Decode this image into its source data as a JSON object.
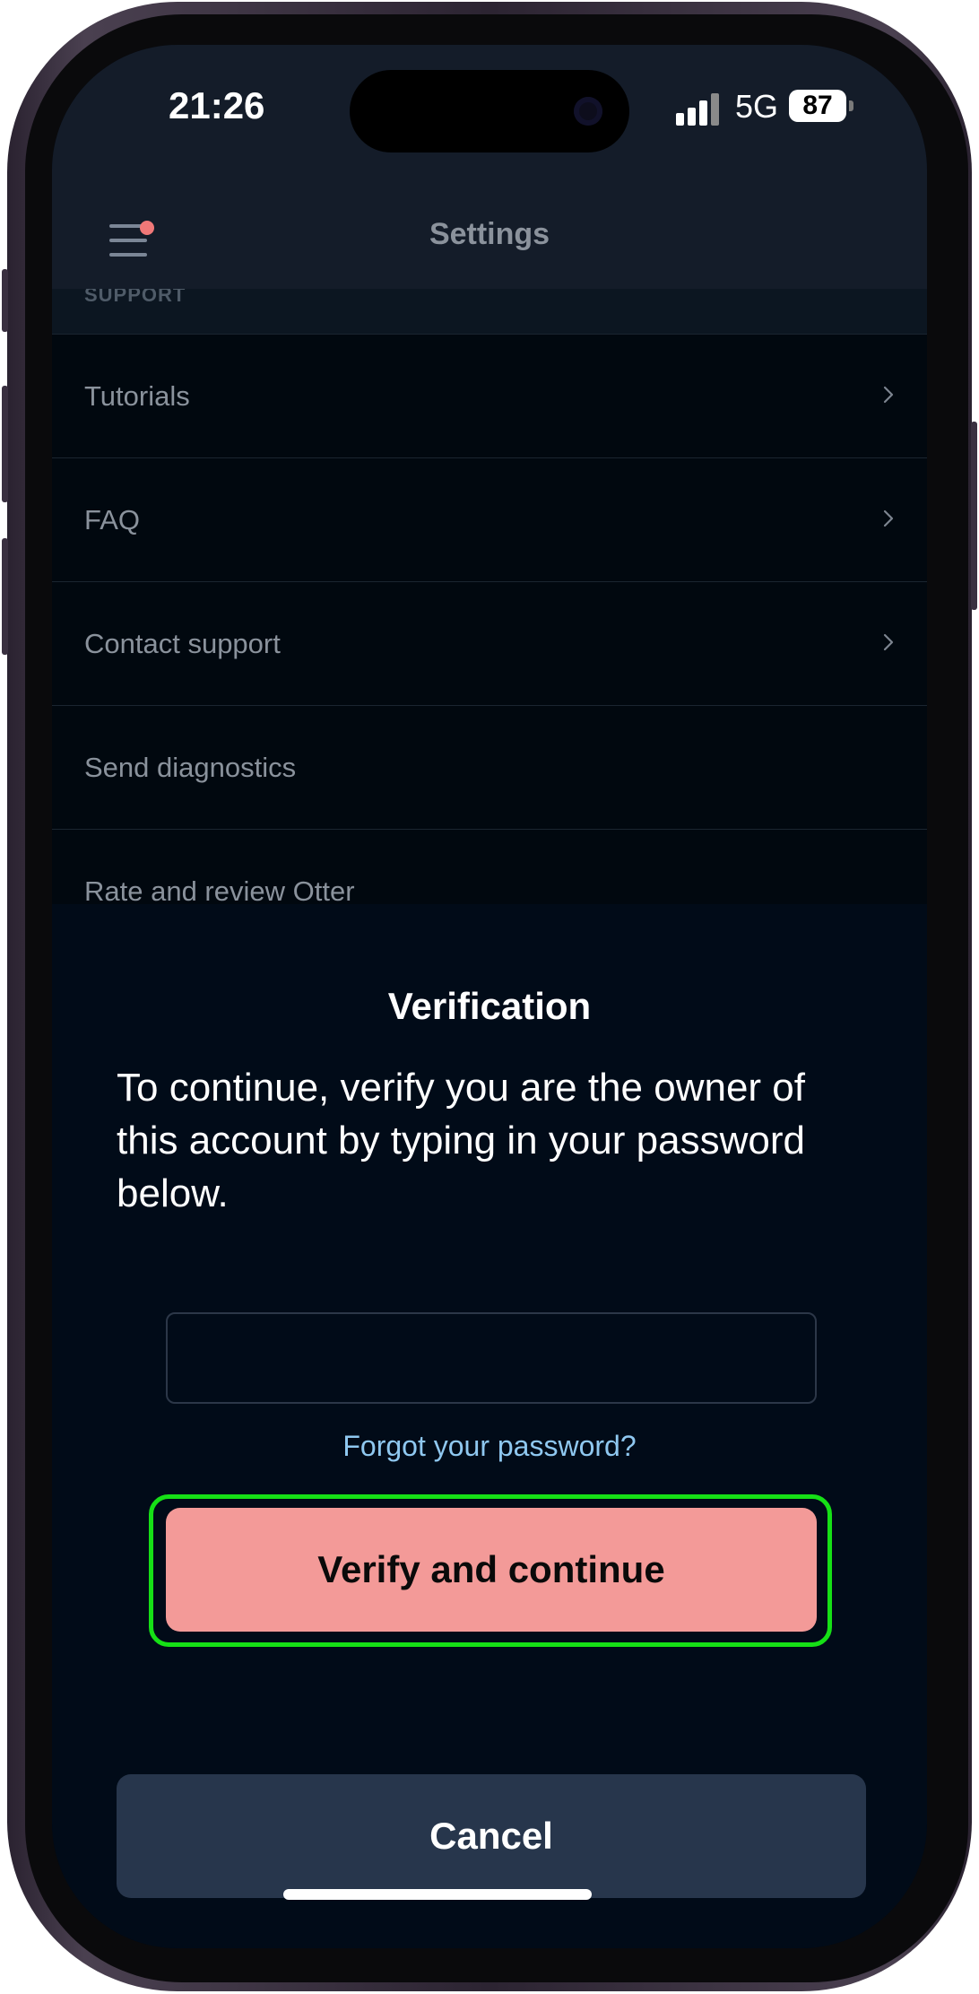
{
  "status_bar": {
    "time": "21:26",
    "network": "5G",
    "battery": "87"
  },
  "header": {
    "title": "Settings",
    "menu_icon": "hamburger-menu-icon",
    "notification_dot_color": "#f07878"
  },
  "section_label": "SUPPORT",
  "settings_items": [
    {
      "label": "Tutorials",
      "chevron": true
    },
    {
      "label": "FAQ",
      "chevron": true
    },
    {
      "label": "Contact support",
      "chevron": true
    },
    {
      "label": "Send diagnostics",
      "chevron": false
    },
    {
      "label": "Rate and review Otter",
      "chevron": false
    }
  ],
  "modal": {
    "title": "Verification",
    "message": "To continue, verify you are the owner of this account by typing in your password below.",
    "password_value": "",
    "forgot_link": "Forgot your password?",
    "verify_label": "Verify and continue",
    "cancel_label": "Cancel"
  },
  "colors": {
    "verify_button": "#f39a98",
    "cancel_button": "#27364c",
    "highlight_outline": "#16e016",
    "link": "#8fc8f0",
    "background": "#010b18"
  }
}
